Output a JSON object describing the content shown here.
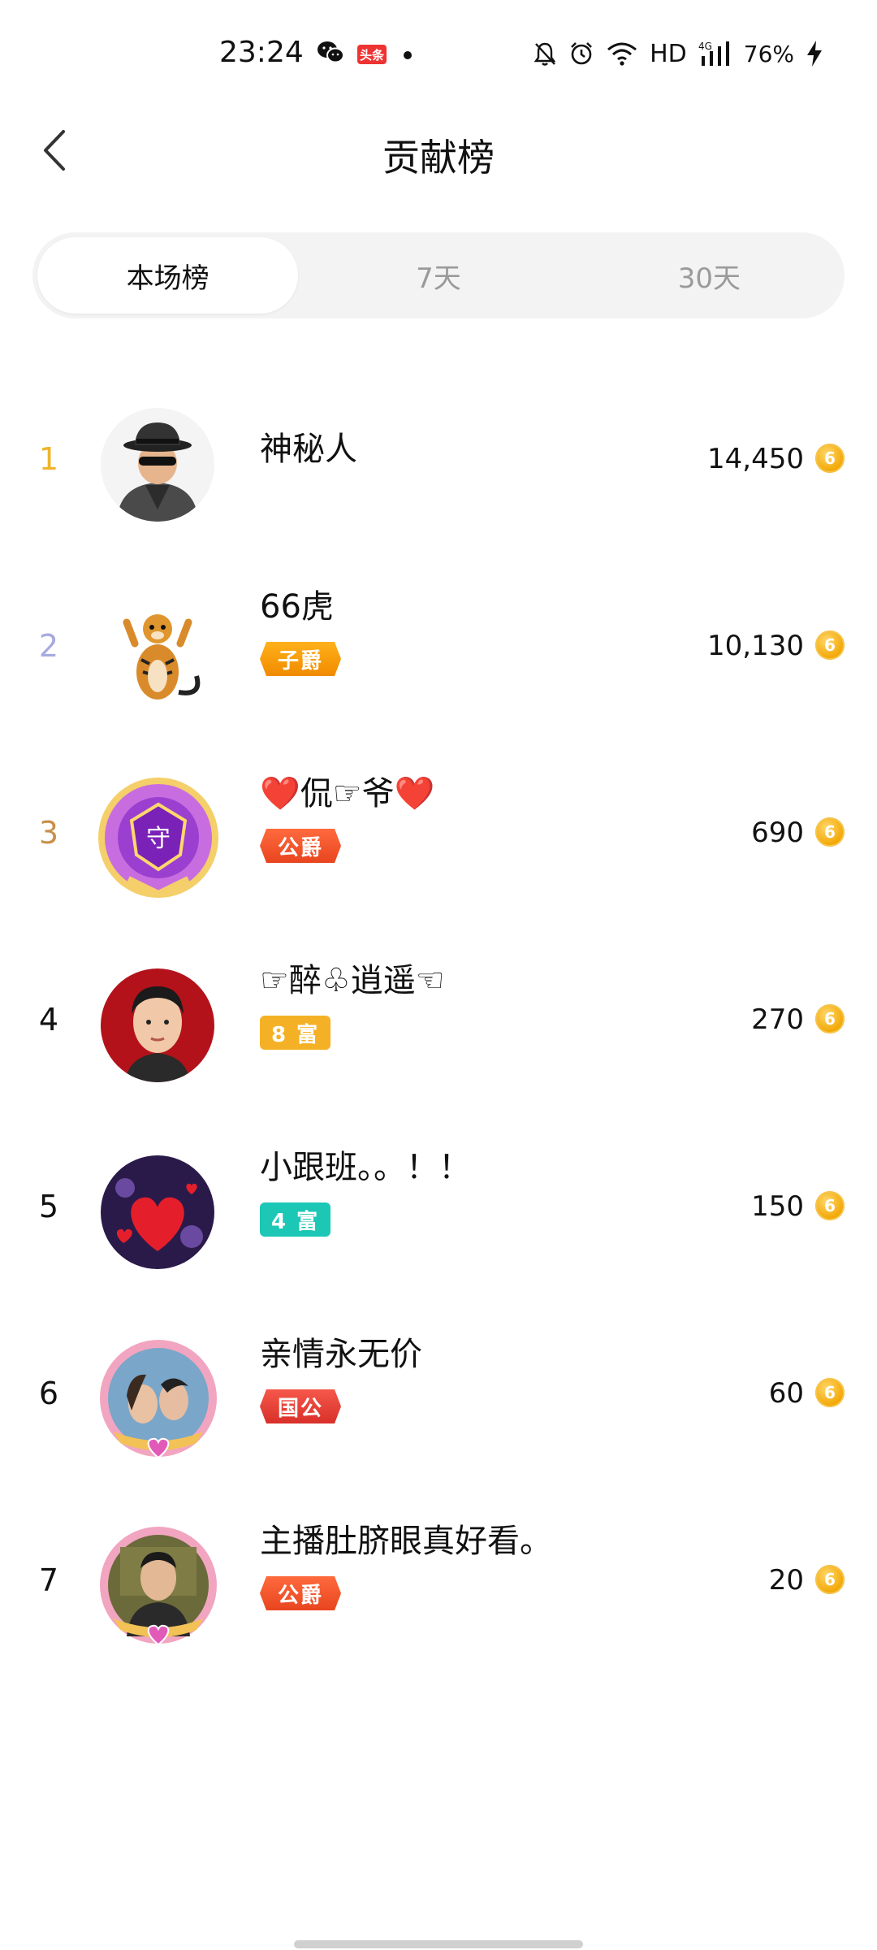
{
  "status_bar": {
    "time": "23:24",
    "toutiao": "头条",
    "network": "HD",
    "signal_type": "4G",
    "battery": "76%",
    "icons": [
      "wechat-icon",
      "toutiao-icon",
      "bell-muted-icon",
      "alarm-icon",
      "wifi-icon",
      "signal-icon",
      "charging-icon"
    ]
  },
  "header": {
    "title": "贡献榜"
  },
  "tabs": [
    {
      "label": "本场榜",
      "active": true
    },
    {
      "label": "7天",
      "active": false
    },
    {
      "label": "30天",
      "active": false
    }
  ],
  "ranking": [
    {
      "rank": "1",
      "rank_color": "#f0b429",
      "name": "神秘人",
      "badge": null,
      "score": "14,450"
    },
    {
      "rank": "2",
      "rank_color": "#a7a9e0",
      "name": "66虎",
      "badge": "子爵",
      "score": "10,130"
    },
    {
      "rank": "3",
      "rank_color": "#c9904a",
      "name": "❤️侃☞爷❤️",
      "badge": "公爵",
      "score": "690"
    },
    {
      "rank": "4",
      "rank_color": "#111111",
      "name": "☞醉♧逍遥☜",
      "badge": "8 富",
      "score": "270"
    },
    {
      "rank": "5",
      "rank_color": "#111111",
      "name": "小跟班。。！！",
      "badge": "4 富",
      "score": "150"
    },
    {
      "rank": "6",
      "rank_color": "#111111",
      "name": "亲情永无价",
      "badge": "国公",
      "score": "60"
    },
    {
      "rank": "7",
      "rank_color": "#111111",
      "name": "主播肚脐眼真好看。",
      "badge": "公爵",
      "score": "20"
    }
  ],
  "coin_symbol": "6",
  "colors": {
    "badge_viscount": "#f59e0b",
    "badge_duke": "#f0552b",
    "badge_wealth8": "#f5b126",
    "badge_wealth4": "#1cc7b6",
    "badge_national_duke": "#e8403a",
    "tab_bg": "#f3f3f3"
  }
}
